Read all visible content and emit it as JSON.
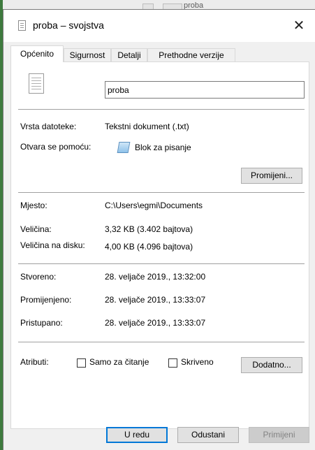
{
  "background": {
    "explorer_item": "proba"
  },
  "dialog": {
    "title": "proba – svojstva",
    "close_glyph": "✕"
  },
  "tabs": [
    {
      "label": "Općenito",
      "active": true
    },
    {
      "label": "Sigurnost",
      "active": false
    },
    {
      "label": "Detalji",
      "active": false
    },
    {
      "label": "Prethodne verzije",
      "active": false
    }
  ],
  "general": {
    "file_name": "proba",
    "file_type_label": "Vrsta datoteke:",
    "file_type_value": "Tekstni dokument (.txt)",
    "opens_with_label": "Otvara se pomoću:",
    "opens_with_value": "Blok za pisanje",
    "change_button": "Promijeni...",
    "location_label": "Mjesto:",
    "location_value": "C:\\Users\\egmi\\Documents",
    "size_label": "Veličina:",
    "size_value": "3,32 KB (3.402 bajtova)",
    "size_on_disk_label": "Veličina na disku:",
    "size_on_disk_value": "4,00 KB (4.096 bajtova)",
    "created_label": "Stvoreno:",
    "created_value": "28. veljače 2019., 13:32:00",
    "modified_label": "Promijenjeno:",
    "modified_value": "28. veljače 2019., 13:33:07",
    "accessed_label": "Pristupano:",
    "accessed_value": "28. veljače 2019., 13:33:07",
    "attributes_label": "Atributi:",
    "readonly_label": "Samo za čitanje",
    "readonly_checked": false,
    "hidden_label": "Skriveno",
    "hidden_checked": false,
    "advanced_button": "Dodatno..."
  },
  "footer": {
    "ok_button": "U redu",
    "cancel_button": "Odustani",
    "apply_button": "Primijeni"
  },
  "colors": {
    "accent": "#0078d7",
    "dialog_bg": "#f0f0f0",
    "panel_bg": "#ffffff"
  }
}
